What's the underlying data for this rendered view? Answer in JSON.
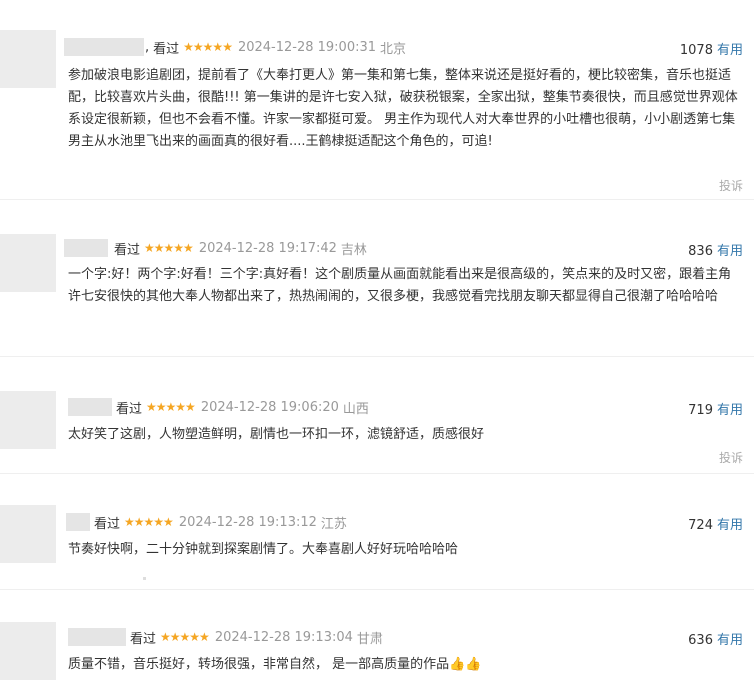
{
  "comments": [
    {
      "status": "看过",
      "stars": "★★★★★",
      "datetime": "2024-12-28 19:00:31",
      "location": "北京",
      "votes": "1078",
      "useful_label": "有用",
      "text": "参加破浪电影追剧团，提前看了《大奉打更人》第一集和第七集，整体来说还是挺好看的，梗比较密集，音乐也挺适配，比较喜欢片头曲，很酷!!! 第一集讲的是许七安入狱，破获税银案，全家出狱，整集节奏很快，而且感觉世界观体系设定很新颖，但也不会看不懂。许家一家都挺可爱。 男主作为现代人对大奉世界的小吐槽也很萌，小小剧透第七集男主从水池里飞出来的画面真的很好看....王鹤棣挺适配这个角色的，可追!",
      "report_label": "投诉"
    },
    {
      "status": "看过",
      "stars": "★★★★★",
      "datetime": "2024-12-28 19:17:42",
      "location": "吉林",
      "votes": "836",
      "useful_label": "有用",
      "text": "一个字:好！两个字:好看！三个字:真好看！这个剧质量从画面就能看出来是很高级的，笑点来的及时又密，跟着主角许七安很快的其他大奉人物都出来了，热热闹闹的，又很多梗，我感觉看完找朋友聊天都显得自己很潮了哈哈哈哈"
    },
    {
      "status": "看过",
      "stars": "★★★★★",
      "datetime": "2024-12-28 19:06:20",
      "location": "山西",
      "votes": "719",
      "useful_label": "有用",
      "text": "太好笑了这剧，人物塑造鲜明，剧情也一环扣一环，滤镜舒适，质感很好",
      "report_label": "投诉"
    },
    {
      "status": "看过",
      "stars": "★★★★★",
      "datetime": "2024-12-28 19:13:12",
      "location": "江苏",
      "votes": "724",
      "useful_label": "有用",
      "text": "节奏好快啊，二十分钟就到探案剧情了。大奉喜剧人好好玩哈哈哈哈"
    },
    {
      "status": "看过",
      "stars": "★★★★★",
      "datetime": "2024-12-28 19:13:04",
      "location": "甘肃",
      "votes": "636",
      "useful_label": "有用",
      "text": "质量不错，音乐挺好，转场很强，非常自然， 是一部高质量的作品👍👍"
    }
  ]
}
